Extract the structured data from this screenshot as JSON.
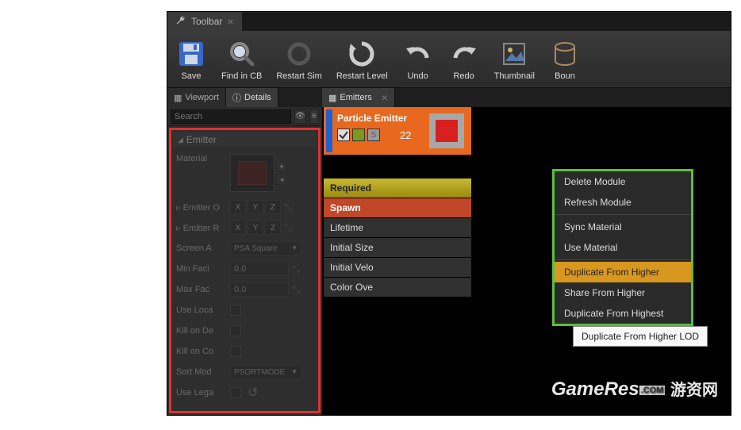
{
  "window": {
    "title": "Toolbar"
  },
  "toolbar": {
    "save": "Save",
    "find_cb": "Find in CB",
    "restart_sim": "Restart Sim",
    "restart_level": "Restart Level",
    "undo": "Undo",
    "redo": "Redo",
    "thumbnail": "Thumbnail",
    "bounds": "Boun"
  },
  "left_tabs": {
    "viewport": "Viewport",
    "details": "Details"
  },
  "search": {
    "placeholder": "Search"
  },
  "emitter_section": {
    "header": "Emitter"
  },
  "props": {
    "material": "Material",
    "emitter_origin": "Emitter O",
    "emitter_rotation": "Emitter R",
    "screen_alignment": "Screen A",
    "screen_alignment_value": "PSA Square",
    "min_facing": "Min Faci",
    "min_facing_value": "0.0",
    "max_facing": "Max Fac",
    "max_facing_value": "0.0",
    "use_local": "Use Loca",
    "kill_on_deactivate": "Kill on De",
    "kill_on_complete": "Kill on Co",
    "sort_mode": "Sort Mod",
    "sort_mode_value": "PSORTMODE",
    "use_legacy": "Use Lega",
    "axes": {
      "x": "X",
      "y": "Y",
      "z": "Z"
    }
  },
  "emitters_tab": "Emitters",
  "particle_emitter": {
    "title": "Particle Emitter",
    "s_label": "S",
    "count": "22"
  },
  "modules": {
    "required": "Required",
    "spawn": "Spawn",
    "lifetime": "Lifetime",
    "initial_size": "Initial Size",
    "initial_velocity": "Initial Velo",
    "color_over": "Color Ove"
  },
  "context_menu": {
    "delete_module": "Delete Module",
    "refresh_module": "Refresh Module",
    "sync_material": "Sync Material",
    "use_material": "Use Material",
    "duplicate_higher": "Duplicate From Higher",
    "share_higher": "Share From Higher",
    "duplicate_highest": "Duplicate From Highest"
  },
  "tooltip": "Duplicate From Higher LOD",
  "watermark": {
    "brand": "GameRes",
    "dotcom": ".COM",
    "cn": "游资网"
  }
}
